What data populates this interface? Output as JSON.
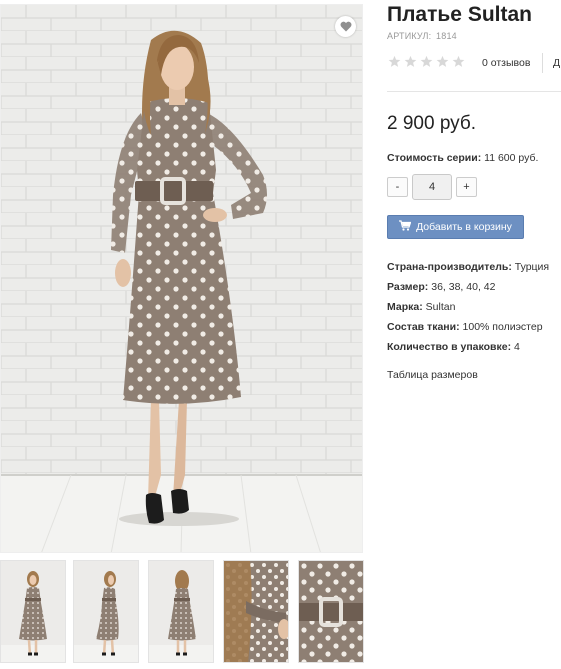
{
  "product": {
    "title": "Платье Sultan",
    "sku_label": "АРТИКУЛ:",
    "sku_value": "1814",
    "rating_stars": 0,
    "rating_max": 5,
    "reviews_text": "0 отзывов",
    "reviews_more": "Д",
    "price": "2 900 руб.",
    "series_label": "Стоимость серии:",
    "series_value": "11 600 руб.",
    "quantity": "4",
    "minus_label": "-",
    "plus_label": "+",
    "add_to_cart": "Добавить в корзину",
    "properties": [
      {
        "label": "Страна-производитель:",
        "value": "Турция"
      },
      {
        "label": "Размер:",
        "value": "36, 38, 40, 42"
      },
      {
        "label": "Марка:",
        "value": "Sultan"
      },
      {
        "label": "Состав ткани:",
        "value": "100% полиэстер"
      },
      {
        "label": "Количество в упаковке:",
        "value": "4"
      }
    ],
    "size_table_link": "Таблица размеров"
  },
  "icons": {
    "favorite": "heart-icon",
    "cart": "cart-icon",
    "star": "star-icon"
  },
  "colors": {
    "dress": "#8e7f73",
    "dots": "#f1ece6",
    "button": "#6d90c2",
    "star_empty": "#d8d8d8"
  },
  "thumbnails": [
    "front-view",
    "side-view",
    "back-view",
    "sleeve-detail",
    "belt-detail"
  ]
}
